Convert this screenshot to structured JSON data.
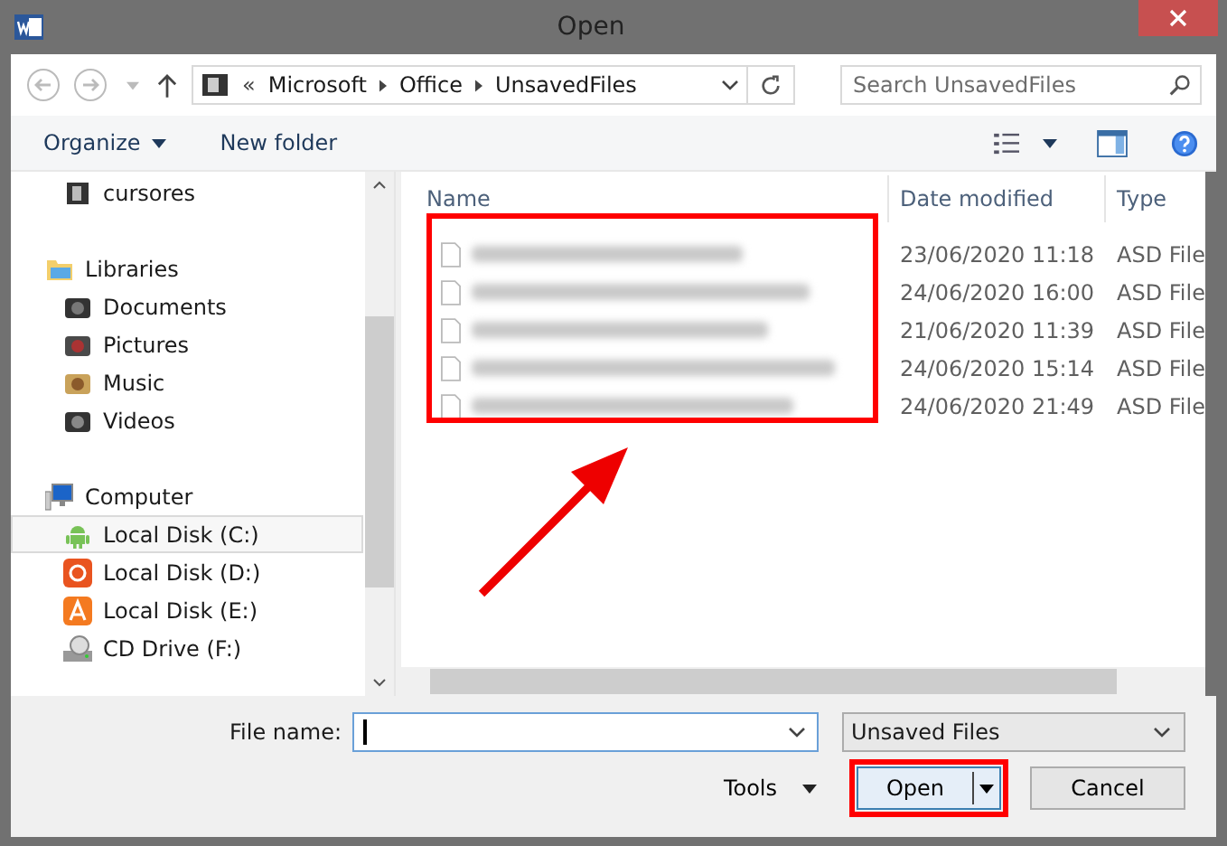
{
  "window": {
    "title": "Open"
  },
  "address": {
    "overflow": "«",
    "path": [
      "Microsoft",
      "Office",
      "UnsavedFiles"
    ]
  },
  "search": {
    "placeholder": "Search UnsavedFiles"
  },
  "toolbar": {
    "organize": "Organize",
    "new_folder": "New folder"
  },
  "sidebar": [
    {
      "items": [
        {
          "label": "cursores",
          "selected": false
        }
      ]
    },
    {
      "header": "Libraries",
      "items": [
        {
          "label": "Documents",
          "selected": false
        },
        {
          "label": "Pictures",
          "selected": false
        },
        {
          "label": "Music",
          "selected": false
        },
        {
          "label": "Videos",
          "selected": false
        }
      ]
    },
    {
      "header": "Computer",
      "items": [
        {
          "label": "Local Disk (C:)",
          "selected": true
        },
        {
          "label": "Local Disk (D:)",
          "selected": false
        },
        {
          "label": "Local Disk (E:)",
          "selected": false
        },
        {
          "label": "CD Drive (F:)",
          "selected": false
        }
      ]
    }
  ],
  "table": {
    "columns": [
      "Name",
      "Date modified",
      "Type"
    ],
    "rows": [
      {
        "date": "23/06/2020 11:18",
        "type": "ASD File"
      },
      {
        "date": "24/06/2020 16:00",
        "type": "ASD File"
      },
      {
        "date": "21/06/2020 11:39",
        "type": "ASD File"
      },
      {
        "date": "24/06/2020 15:14",
        "type": "ASD File"
      },
      {
        "date": "24/06/2020 21:49",
        "type": "ASD File"
      }
    ]
  },
  "file_name": {
    "label": "File name:"
  },
  "file_type": {
    "value": "Unsaved Files"
  },
  "buttons": {
    "tools": "Tools",
    "open": "Open",
    "cancel": "Cancel"
  }
}
